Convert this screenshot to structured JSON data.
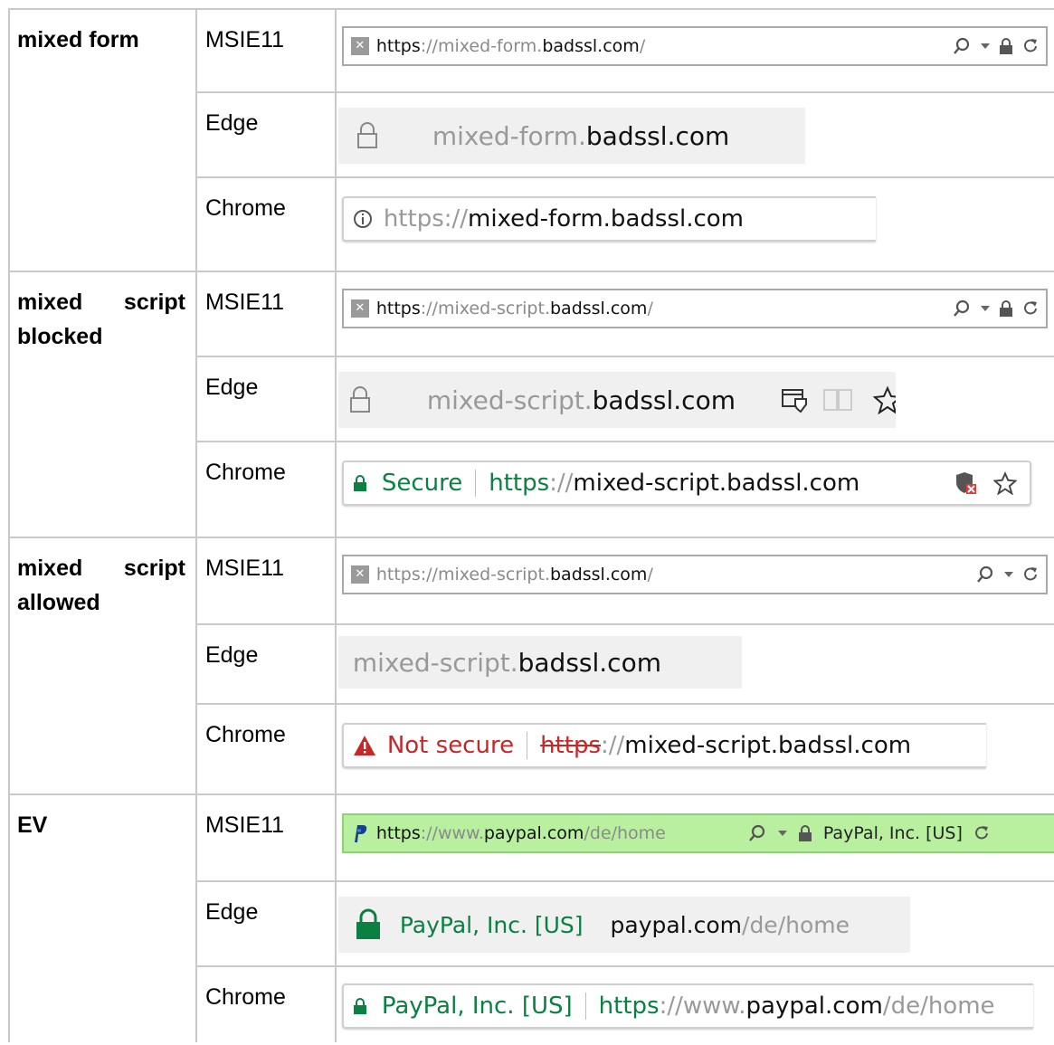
{
  "rows": [
    {
      "category": "mixed form",
      "msie": {
        "browser": "MSIE11",
        "scheme": "https",
        "rest": "://mixed-form.",
        "domain": "badssl.com",
        "tail": "/"
      },
      "edge": {
        "browser": "Edge",
        "sub": "mixed-form.",
        "domain": "badssl.com"
      },
      "chrome": {
        "browser": "Chrome",
        "scheme": "https",
        "sep": "://",
        "rest": "mixed-form.badssl.com"
      }
    },
    {
      "category": "mixed script blocked",
      "msie": {
        "browser": "MSIE11",
        "scheme": "https",
        "rest": "://mixed-script.",
        "domain": "badssl.com",
        "tail": "/"
      },
      "edge": {
        "browser": "Edge",
        "sub": "mixed-script.",
        "domain": "badssl.com"
      },
      "chrome": {
        "browser": "Chrome",
        "status": "Secure",
        "scheme": "https",
        "sep": "://",
        "rest": "mixed-script.badssl.com"
      }
    },
    {
      "category": "mixed script allowed",
      "msie": {
        "browser": "MSIE11",
        "scheme": "https",
        "rest": "://mixed-script.",
        "domain": "badssl.com",
        "tail": "/"
      },
      "edge": {
        "browser": "Edge",
        "sub": "mixed-script.",
        "domain": "badssl.com"
      },
      "chrome": {
        "browser": "Chrome",
        "status": "Not secure",
        "scheme": "https",
        "sep": "://",
        "rest": "mixed-script.badssl.com"
      }
    },
    {
      "category": "EV",
      "msie": {
        "browser": "MSIE11",
        "scheme": "https",
        "rest": "://www.",
        "domain": "paypal.com",
        "tail": "/de/home",
        "ev_name": "PayPal, Inc. [US]"
      },
      "edge": {
        "browser": "Edge",
        "ev_name": "PayPal, Inc. [US]",
        "domain": "paypal.com",
        "tail": "/de/home"
      },
      "chrome": {
        "browser": "Chrome",
        "ev_name": "PayPal, Inc. [US]",
        "scheme": "https",
        "sep": "://www.",
        "domain": "paypal.com",
        "tail": "/de/home"
      }
    }
  ],
  "colors": {
    "ev_green": "#0b8043",
    "warning_red": "#c62828",
    "ie_ev_bar": "#b8f0a0",
    "edge_bar": "#f0f0f0"
  },
  "icons": [
    "site-icon",
    "paypal-icon",
    "search-icon",
    "dropdown-icon",
    "lock-icon",
    "refresh-icon",
    "info-icon",
    "shield-icon",
    "reading-icon",
    "star-icon",
    "warning-icon",
    "blocked-shield-icon"
  ]
}
